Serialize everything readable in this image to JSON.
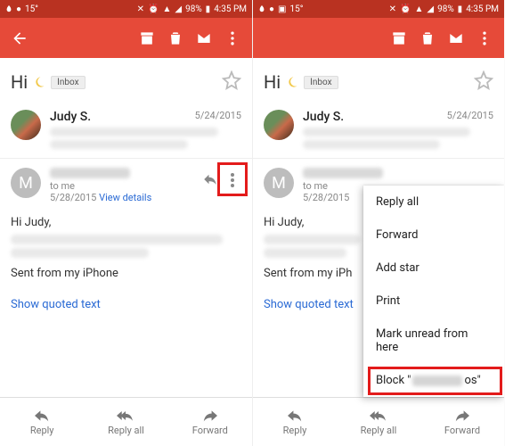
{
  "status": {
    "temp": "15°",
    "battery": "98%",
    "time": "4:35 PM"
  },
  "subject": "Hi",
  "chip": "Inbox",
  "msg1": {
    "sender": "Judy S.",
    "date": "5/24/2015"
  },
  "msg2": {
    "avatar_letter": "M",
    "to": "to me",
    "date": "5/28/2015",
    "details_link": "View details"
  },
  "body": {
    "greeting": "Hi Judy,",
    "signature": "Sent from my iPhone",
    "signature_trunc": "Sent from my iPh",
    "quoted": "Show quoted text"
  },
  "bottom": {
    "reply": "Reply",
    "reply_all": "Reply all",
    "forward": "Forward"
  },
  "menu": {
    "reply_all": "Reply all",
    "forward": "Forward",
    "add_star": "Add star",
    "print": "Print",
    "mark_unread": "Mark unread from here",
    "block_prefix": "Block \"",
    "block_suffix": "os\""
  }
}
